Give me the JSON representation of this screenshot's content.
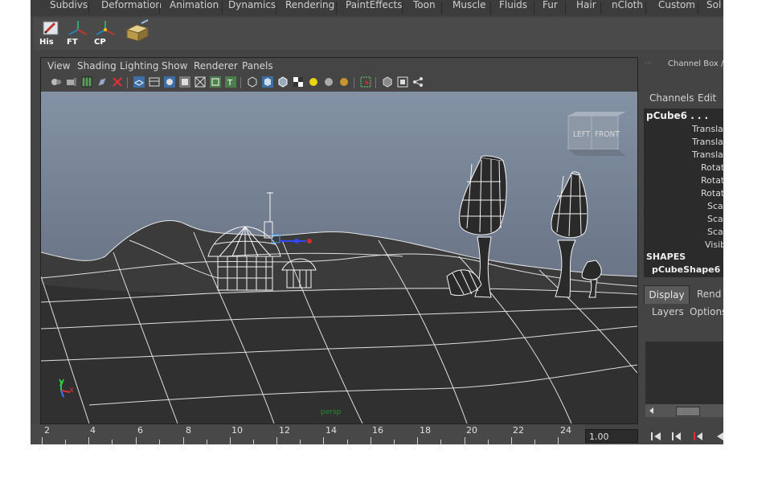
{
  "menubar": {
    "items": [
      "Subdivs",
      "Deformation",
      "Animation",
      "Dynamics",
      "Rendering",
      "PaintEffects",
      "Toon",
      "Muscle",
      "Fluids",
      "Fur",
      "Hair",
      "nCloth",
      "Custom",
      "Sol"
    ]
  },
  "shelf": {
    "buttons": [
      {
        "label": "His",
        "icon": "history-pencil-icon"
      },
      {
        "label": "FT",
        "icon": "freeze-transform-icon"
      },
      {
        "label": "CP",
        "icon": "center-pivot-icon"
      },
      {
        "label": "",
        "icon": "uv-box-icon"
      }
    ]
  },
  "viewport": {
    "menu": [
      "View",
      "Shading",
      "Lighting",
      "Show",
      "Renderer",
      "Panels"
    ],
    "camera_label": "persp",
    "viewcube": {
      "left": "LEFT",
      "front": "FRONT"
    },
    "axis": {
      "y": "y",
      "x": "x"
    }
  },
  "timeline": {
    "ticks": [
      "2",
      "4",
      "6",
      "8",
      "10",
      "12",
      "14",
      "16",
      "18",
      "20",
      "22",
      "24"
    ],
    "current_frame": "1.00"
  },
  "channel_box": {
    "title": "Channel Box / La",
    "menu": [
      "Channels",
      "Edit"
    ],
    "object": "pCube6 . . .",
    "attributes": [
      "Translat",
      "Translat",
      "Translat",
      "Rotat",
      "Rotat",
      "Rotat",
      "Sca",
      "Sca",
      "Sca",
      "Visib"
    ],
    "shapes_header": "SHAPES",
    "shape_name": "pCubeShape6"
  },
  "layer_editor": {
    "tabs": [
      "Display",
      "Rend"
    ],
    "menu": [
      "Layers",
      "Options"
    ]
  },
  "colors": {
    "app_bg": "#444444",
    "list_bg": "#2b2b2b",
    "sky_top": "#8492a5",
    "ground": "#3a3a3a"
  }
}
